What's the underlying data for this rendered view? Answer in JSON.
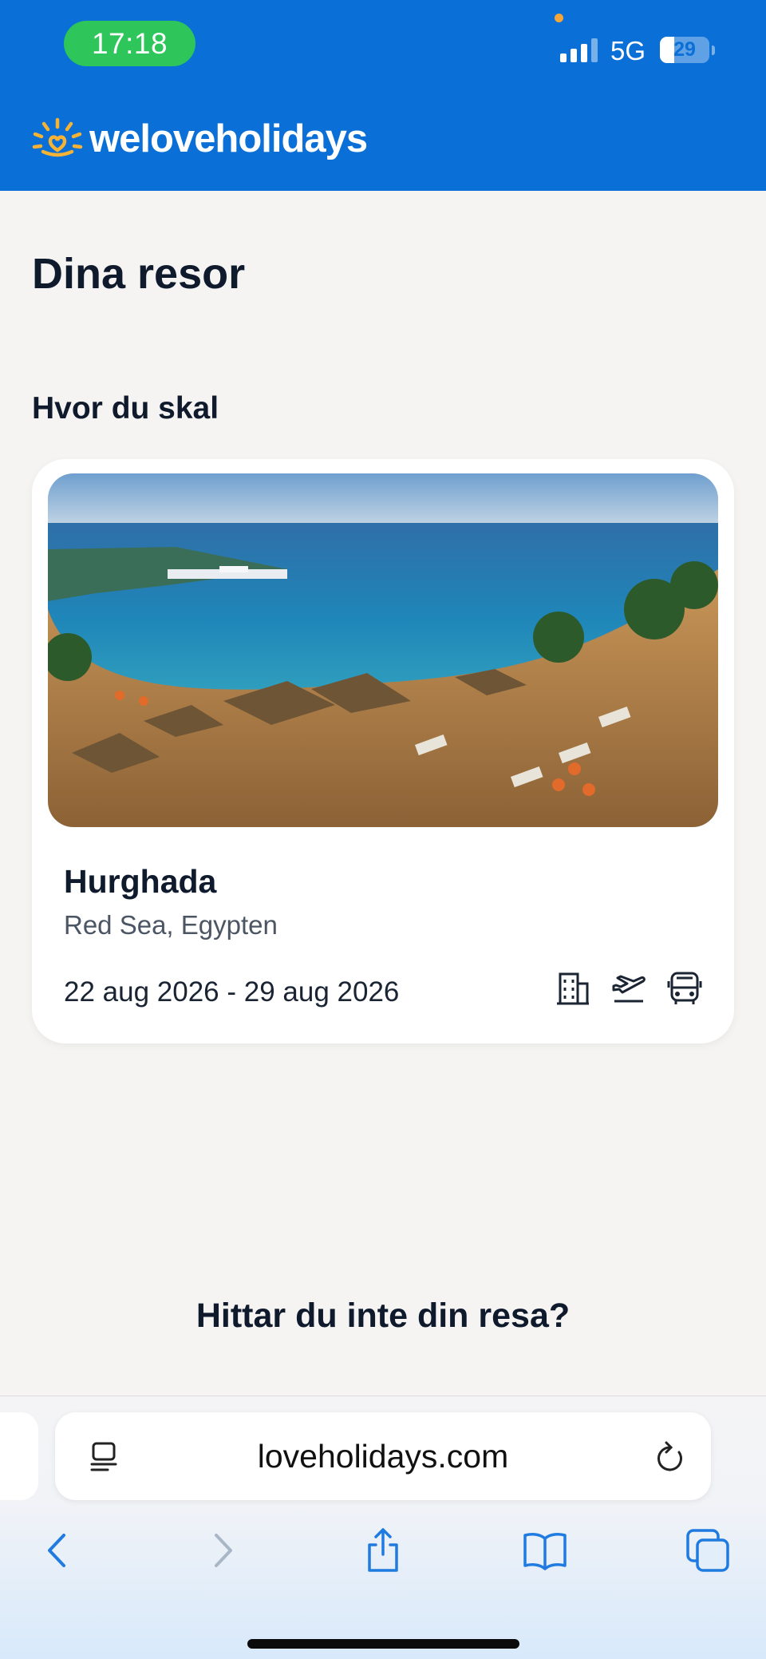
{
  "status_bar": {
    "time": "17:18",
    "network": "5G",
    "battery": "29"
  },
  "header": {
    "logo_text": "weloveholidays",
    "brand_color": "#0a6fd6",
    "logo_sun_color": "#f5b335"
  },
  "page": {
    "title": "Dina resor",
    "section_title": "Hvor du skal",
    "help_title": "Hittar du inte din resa?"
  },
  "trip": {
    "name": "Hurghada",
    "region": "Red Sea, Egypten",
    "dates": "22 aug 2026 - 29 aug 2026",
    "photo_icon": "beach-photo",
    "included_icons": [
      "hotel-icon",
      "flight-icon",
      "bus-transfer-icon"
    ]
  },
  "browser": {
    "url": "loveholidays.com",
    "toolbar_icons": [
      "back-icon",
      "forward-icon",
      "share-icon",
      "bookmarks-icon",
      "tabs-icon"
    ]
  }
}
